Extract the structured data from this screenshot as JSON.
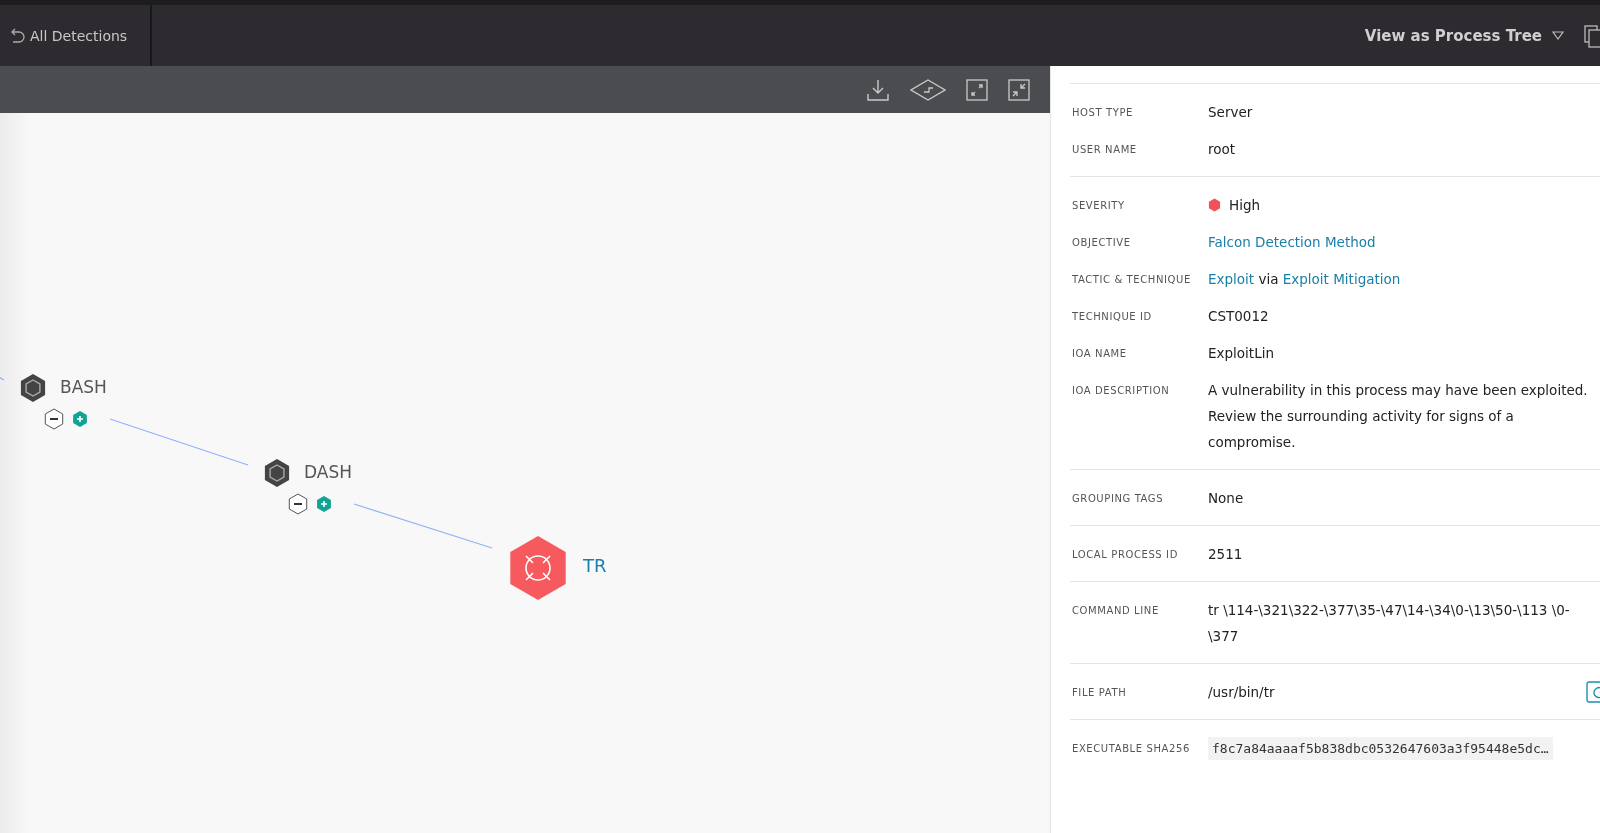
{
  "header": {
    "back_label": "All Detections",
    "view_label": "View as Process Tree"
  },
  "graph": {
    "nodes": [
      {
        "name": "BASH",
        "kind": "process"
      },
      {
        "name": "DASH",
        "kind": "process"
      },
      {
        "name": "TR",
        "kind": "detection"
      }
    ]
  },
  "details": [
    {
      "label": "HOST TYPE",
      "kind": "text",
      "value": "Server"
    },
    {
      "label": "USER NAME",
      "kind": "text",
      "value": "root",
      "divider": true
    },
    {
      "label": "SEVERITY",
      "kind": "severity",
      "value": "High",
      "color": "#f0515a"
    },
    {
      "label": "OBJECTIVE",
      "kind": "link",
      "value": "Falcon Detection Method"
    },
    {
      "label": "TACTIC & TECHNIQUE",
      "kind": "tactic",
      "parts": [
        {
          "text": "Exploit",
          "link": true
        },
        {
          "text": "via",
          "link": false
        },
        {
          "text": "Exploit Mitigation",
          "link": true
        }
      ]
    },
    {
      "label": "TECHNIQUE ID",
      "kind": "text",
      "value": "CST0012"
    },
    {
      "label": "IOA NAME",
      "kind": "text",
      "value": "ExploitLin"
    },
    {
      "label": "IOA DESCRIPTION",
      "kind": "text",
      "value": "A vulnerability in this process may have been exploited. Review the surrounding activity for signs of a compromise.",
      "divider": true
    },
    {
      "label": "GROUPING TAGS",
      "kind": "text",
      "value": "None",
      "divider": true
    },
    {
      "label": "LOCAL PROCESS ID",
      "kind": "text",
      "value": "2511",
      "divider": true
    },
    {
      "label": "COMMAND LINE",
      "kind": "text",
      "value": "tr \\114-\\321\\322-\\377\\35-\\47\\14-\\34\\0-\\13\\50-\\113 \\0-\\377",
      "divider": true
    },
    {
      "label": "FILE PATH",
      "kind": "path",
      "value": "/usr/bin/tr",
      "divider": true
    },
    {
      "label": "EXECUTABLE SHA256",
      "kind": "mono",
      "value": "f8c7a84aaaaf5b838dbc0532647603a3f95448e5dc…"
    }
  ]
}
